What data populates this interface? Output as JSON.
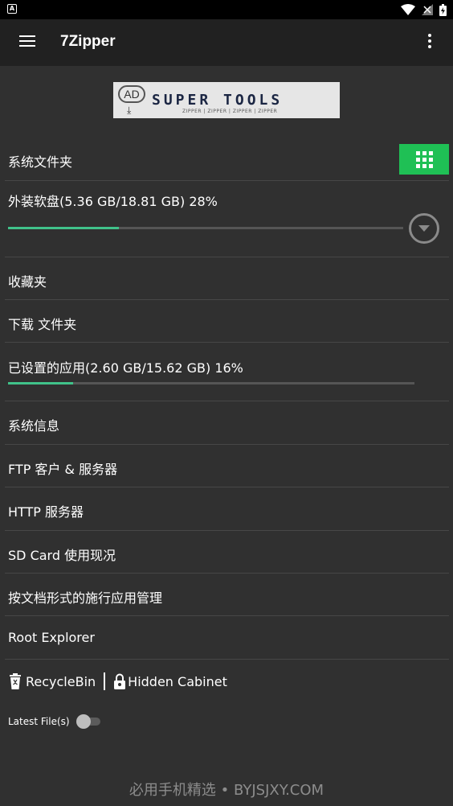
{
  "status_bar": {
    "left_icon": "A"
  },
  "app_bar": {
    "title": "7Zipper",
    "menu_icon": "hamburger-icon",
    "overflow_icon": "more-vert-icon"
  },
  "ad": {
    "badge": "AD",
    "title": "SUPER TOOLS",
    "subtitle": "ZIPPER | ZIPPER | ZIPPER | ZIPPER"
  },
  "sections": {
    "system_folder": "系统文件夹",
    "external_storage": {
      "label": "外装软盘(5.36 GB/18.81 GB) 28%",
      "percent": 28
    },
    "favorites": "收藏夹",
    "downloads": "下载 文件夹",
    "installed_apps": {
      "label": "已设置的应用(2.60 GB/15.62 GB) 16%",
      "percent": 16
    },
    "system_info": "系统信息",
    "ftp": "FTP 客户 & 服务器",
    "http": "HTTP 服务器",
    "sd_card": "SD Card 使用现况",
    "app_manager": "按文档形式的施行应用管理",
    "root_explorer": "Root Explorer"
  },
  "bottom_links": {
    "recycle_bin": "RecycleBin",
    "hidden_cabinet": "Hidden Cabinet"
  },
  "latest_files": {
    "label": "Latest File(s)",
    "enabled": false
  },
  "watermark": "必用手机精选 • BYJSJXY.COM",
  "colors": {
    "accent_green": "#1fc055",
    "progress": "#40c28a",
    "background": "#303030",
    "appbar": "#212121"
  }
}
